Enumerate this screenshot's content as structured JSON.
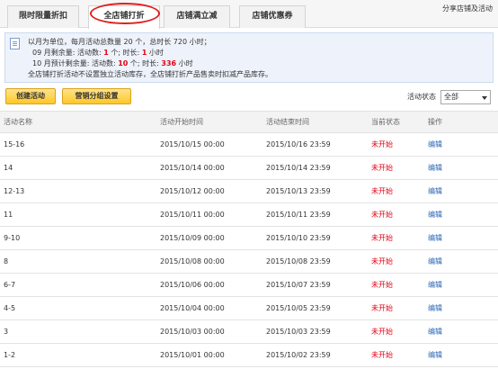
{
  "tabs": [
    {
      "label": "限时限量折扣"
    },
    {
      "label": "全店铺打折"
    },
    {
      "label": "店铺满立减"
    },
    {
      "label": "店铺优惠券"
    }
  ],
  "share_link": "分享店铺及活动",
  "notice": {
    "line1": "以月为单位，每月活动总数量 20 个，总时长 720 小时；",
    "line2_prefix": "09 月剩余量: 活动数: ",
    "line2_count": "1",
    "line2_mid": " 个; 时长: ",
    "line2_hours": "1",
    "line2_suffix": " 小时",
    "line3_prefix": "10 月预计剩余量: 活动数: ",
    "line3_count": "10",
    "line3_mid": " 个; 时长: ",
    "line3_hours": "336",
    "line3_suffix": " 小时",
    "line4": "全店铺打折活动不设置独立活动库存，全店铺打折产品售卖时扣减产品库存。"
  },
  "toolbar": {
    "create_label": "创建活动",
    "group_label": "营销分组设置",
    "filter_label": "活动状态",
    "filter_value": "全部"
  },
  "table": {
    "headers": [
      "活动名称",
      "活动开始时间",
      "活动结束时间",
      "当前状态",
      "操作"
    ],
    "rows": [
      {
        "name": "15-16",
        "start": "2015/10/15 00:00",
        "end": "2015/10/16 23:59",
        "status": "未开始",
        "action": "编辑"
      },
      {
        "name": "14",
        "start": "2015/10/14 00:00",
        "end": "2015/10/14 23:59",
        "status": "未开始",
        "action": "编辑"
      },
      {
        "name": "12-13",
        "start": "2015/10/12 00:00",
        "end": "2015/10/13 23:59",
        "status": "未开始",
        "action": "编辑"
      },
      {
        "name": "11",
        "start": "2015/10/11 00:00",
        "end": "2015/10/11 23:59",
        "status": "未开始",
        "action": "编辑"
      },
      {
        "name": "9-10",
        "start": "2015/10/09 00:00",
        "end": "2015/10/10 23:59",
        "status": "未开始",
        "action": "编辑"
      },
      {
        "name": "8",
        "start": "2015/10/08 00:00",
        "end": "2015/10/08 23:59",
        "status": "未开始",
        "action": "编辑"
      },
      {
        "name": "6-7",
        "start": "2015/10/06 00:00",
        "end": "2015/10/07 23:59",
        "status": "未开始",
        "action": "编辑"
      },
      {
        "name": "4-5",
        "start": "2015/10/04 00:00",
        "end": "2015/10/05 23:59",
        "status": "未开始",
        "action": "编辑"
      },
      {
        "name": "3",
        "start": "2015/10/03 00:00",
        "end": "2015/10/03 23:59",
        "status": "未开始",
        "action": "编辑"
      },
      {
        "name": "1-2",
        "start": "2015/10/01 00:00",
        "end": "2015/10/02 23:59",
        "status": "未开始",
        "action": "编辑"
      }
    ]
  },
  "colors": {
    "status_red": "#e60012",
    "link_blue": "#2a66b5",
    "button_yellow": "#ffc727"
  }
}
